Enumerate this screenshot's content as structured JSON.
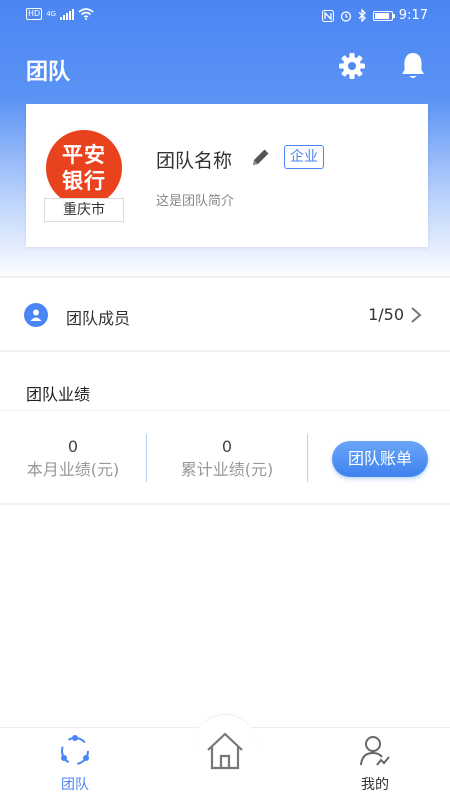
{
  "status_bar": {
    "hd": "HD",
    "network": "4G",
    "time": "9:17"
  },
  "header": {
    "title": "团队",
    "settings_icon": "gear-icon",
    "notification_icon": "bell-icon"
  },
  "team": {
    "logo_text_line1": "平安",
    "logo_text_line2": "银行",
    "city": "重庆市",
    "name": "团队名称",
    "badge": "企业",
    "description": "这是团队简介"
  },
  "members": {
    "label": "团队成员",
    "count": "1/50"
  },
  "performance": {
    "title": "团队业绩",
    "monthly_value": "0",
    "monthly_label": "本月业绩(元)",
    "total_value": "0",
    "total_label": "累计业绩(元)",
    "bill_button": "团队账单"
  },
  "tabbar": {
    "team_label": "团队",
    "mine_label": "我的"
  },
  "colors": {
    "accent": "#4a86f3",
    "logo_red": "#e8421f"
  }
}
